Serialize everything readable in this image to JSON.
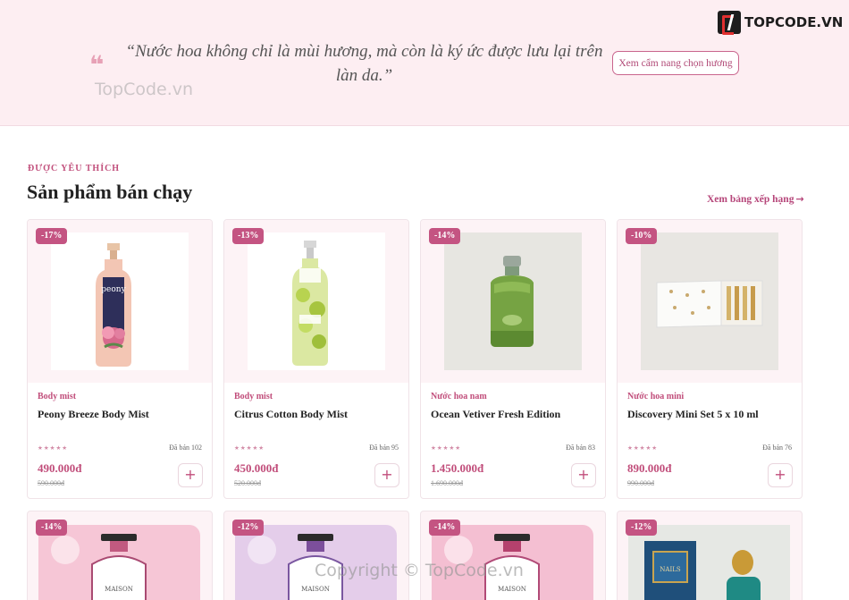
{
  "hero": {
    "quote_mark": "❝",
    "quote": "“Nước hoa không chỉ là mùi hương, mà còn là ký ức được lưu lại trên làn da.”",
    "guide_button": "Xem cẩm nang chọn hương",
    "watermark": "TopCode.vn"
  },
  "brand": {
    "name": "TOPCODE.VN"
  },
  "section": {
    "eyebrow": "ĐƯỢC YÊU THÍCH",
    "title": "Sản phẩm bán chạy",
    "see_ranking": "Xem bảng xếp hạng",
    "arrow": "→"
  },
  "products": [
    {
      "discount": "-17%",
      "category": "Body mist",
      "name": "Peony Breeze Body Mist",
      "stars": "★★★★★",
      "sold": "Đã bán 102",
      "price": "490.000đ",
      "old_price": "590.000đ",
      "add": "+"
    },
    {
      "discount": "-13%",
      "category": "Body mist",
      "name": "Citrus Cotton Body Mist",
      "stars": "★★★★★",
      "sold": "Đã bán 95",
      "price": "450.000đ",
      "old_price": "520.000đ",
      "add": "+"
    },
    {
      "discount": "-14%",
      "category": "Nước hoa nam",
      "name": "Ocean Vetiver Fresh Edition",
      "stars": "★★★★★",
      "sold": "Đã bán 83",
      "price": "1.450.000đ",
      "old_price": "1.690.000đ",
      "add": "+"
    },
    {
      "discount": "-10%",
      "category": "Nước hoa mini",
      "name": "Discovery Mini Set 5 x 10 ml",
      "stars": "★★★★★",
      "sold": "Đã bán 76",
      "price": "890.000đ",
      "old_price": "990.000đ",
      "add": "+"
    }
  ],
  "products_row2": [
    {
      "discount": "-14%",
      "bottle_label": "MAISON"
    },
    {
      "discount": "-12%",
      "bottle_label": "MAISON"
    },
    {
      "discount": "-14%",
      "bottle_label": "MAISON"
    },
    {
      "discount": "-12%",
      "bottle_label": "NAILS"
    }
  ],
  "footer": {
    "watermark": "Copyright © TopCode.vn"
  }
}
